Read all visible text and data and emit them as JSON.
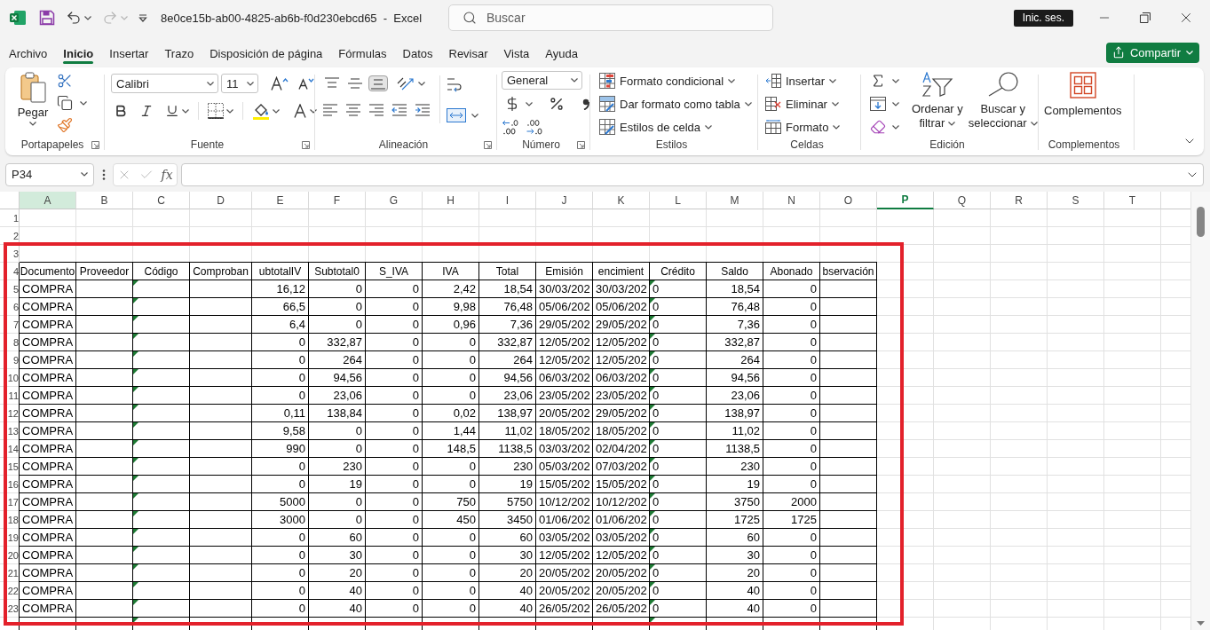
{
  "title_bar": {
    "title": "8e0ce15b-ab00-4825-ab6b-f0d230ebcd65  -  Excel",
    "redo": {
      "disabled": true
    },
    "search": {
      "placeholder": "Buscar"
    },
    "sign_in": "Inic. ses."
  },
  "menu": {
    "tabs": [
      {
        "label": "Archivo",
        "selected": false
      },
      {
        "label": "Inicio",
        "selected": true
      },
      {
        "label": "Insertar",
        "selected": false
      },
      {
        "label": "Trazo",
        "selected": false
      },
      {
        "label": "Disposición de página",
        "selected": false
      },
      {
        "label": "Fórmulas",
        "selected": false
      },
      {
        "label": "Datos",
        "selected": false
      },
      {
        "label": "Revisar",
        "selected": false
      },
      {
        "label": "Vista",
        "selected": false
      },
      {
        "label": "Ayuda",
        "selected": false
      }
    ],
    "share": "Compartir"
  },
  "ribbon": {
    "clipboard": {
      "paste": "Pegar",
      "label": "Portapapeles"
    },
    "font": {
      "font_name": "Calibri",
      "font_size": "11",
      "label": "Fuente"
    },
    "alignment": {
      "vertical": [
        {
          "selected": false
        },
        {
          "selected": false
        },
        {
          "selected": true
        }
      ],
      "label": "Alineación"
    },
    "number": {
      "format": "General",
      "label": "Número"
    },
    "styles": {
      "items": [
        "Formato condicional",
        "Dar formato como tabla",
        "Estilos de celda"
      ],
      "label": "Estilos"
    },
    "cells": {
      "items": [
        "Insertar",
        "Eliminar",
        "Formato"
      ],
      "label": "Celdas"
    },
    "editing": {
      "sort": [
        "Ordenar y",
        "filtrar"
      ],
      "find": [
        "Buscar y",
        "seleccionar"
      ],
      "label": "Edición"
    },
    "add_ins": {
      "button": "Complementos",
      "label": "Complementos"
    }
  },
  "formula_bar": {
    "name_box": "P34",
    "edit_buttons": {
      "disabled": true
    },
    "function_label": "fx"
  },
  "sheet": {
    "columns": [
      {
        "letter": "A",
        "selected": false,
        "shaded": true,
        "flagged": false,
        "right_aligned": false
      },
      {
        "letter": "B",
        "selected": false,
        "shaded": false,
        "flagged": false
      },
      {
        "letter": "C",
        "selected": false,
        "shaded": false,
        "flagged": true
      },
      {
        "letter": "D",
        "selected": false,
        "shaded": false,
        "flagged": false
      },
      {
        "letter": "E",
        "selected": false,
        "shaded": false,
        "flagged": false,
        "right_aligned": true
      },
      {
        "letter": "F",
        "selected": false,
        "shaded": false,
        "flagged": false,
        "right_aligned": true
      },
      {
        "letter": "G",
        "selected": false,
        "shaded": false,
        "flagged": false,
        "right_aligned": true
      },
      {
        "letter": "H",
        "selected": false,
        "shaded": false,
        "flagged": false,
        "right_aligned": true
      },
      {
        "letter": "I",
        "selected": false,
        "shaded": false,
        "flagged": false,
        "right_aligned": true
      },
      {
        "letter": "J",
        "selected": false,
        "shaded": false,
        "flagged": false,
        "right_aligned": false
      },
      {
        "letter": "K",
        "selected": false,
        "shaded": false,
        "flagged": false,
        "right_aligned": false
      },
      {
        "letter": "L",
        "selected": false,
        "shaded": false,
        "flagged": true,
        "right_aligned": false
      },
      {
        "letter": "M",
        "selected": false,
        "shaded": false,
        "flagged": false,
        "right_aligned": true
      },
      {
        "letter": "N",
        "selected": false,
        "shaded": false,
        "flagged": false,
        "right_aligned": true
      },
      {
        "letter": "O",
        "selected": false,
        "shaded": false,
        "flagged": false
      },
      {
        "letter": "P",
        "selected": true,
        "shaded": false,
        "flagged": false
      },
      {
        "letter": "Q",
        "selected": false,
        "shaded": false,
        "flagged": false
      },
      {
        "letter": "R",
        "selected": false,
        "shaded": false,
        "flagged": false
      },
      {
        "letter": "S",
        "selected": false,
        "shaded": false,
        "flagged": false
      },
      {
        "letter": "T",
        "selected": false,
        "shaded": false,
        "flagged": false
      }
    ],
    "rows": [
      {
        "number": "1",
        "kind": "blank"
      },
      {
        "number": "2",
        "kind": "blank"
      },
      {
        "number": "3",
        "kind": "blank"
      },
      {
        "number": "4",
        "kind": "header",
        "cells": [
          "Documento",
          "Proveedor",
          "Código",
          "Comproban",
          "ubtotalIV",
          "Subtotal0",
          "S_IVA",
          "IVA",
          "Total",
          "Emisión",
          "encimient",
          "Crédito",
          "Saldo",
          "Abonado",
          "bservación"
        ]
      },
      {
        "number": "5",
        "kind": "data",
        "cells": [
          "COMPRA",
          null,
          null,
          null,
          "16,12",
          "0",
          "0",
          "2,42",
          "18,54",
          "30/03/202",
          "30/03/202",
          "0",
          "18,54",
          "0"
        ]
      },
      {
        "number": "6",
        "kind": "data",
        "cells": [
          "COMPRA",
          null,
          null,
          null,
          "66,5",
          "0",
          "0",
          "9,98",
          "76,48",
          "05/06/202",
          "05/06/202",
          "0",
          "76,48",
          "0"
        ]
      },
      {
        "number": "7",
        "kind": "data",
        "cells": [
          "COMPRA",
          null,
          null,
          null,
          "6,4",
          "0",
          "0",
          "0,96",
          "7,36",
          "29/05/202",
          "29/05/202",
          "0",
          "7,36",
          "0"
        ]
      },
      {
        "number": "8",
        "kind": "data",
        "cells": [
          "COMPRA",
          null,
          null,
          null,
          "0",
          "332,87",
          "0",
          "0",
          "332,87",
          "12/05/202",
          "12/05/202",
          "0",
          "332,87",
          "0"
        ]
      },
      {
        "number": "9",
        "kind": "data",
        "cells": [
          "COMPRA",
          null,
          null,
          null,
          "0",
          "264",
          "0",
          "0",
          "264",
          "12/05/202",
          "12/05/202",
          "0",
          "264",
          "0"
        ]
      },
      {
        "number": "10",
        "kind": "data",
        "cells": [
          "COMPRA",
          null,
          null,
          null,
          "0",
          "94,56",
          "0",
          "0",
          "94,56",
          "06/03/202",
          "06/03/202",
          "0",
          "94,56",
          "0"
        ]
      },
      {
        "number": "11",
        "kind": "data",
        "cells": [
          "COMPRA",
          null,
          null,
          null,
          "0",
          "23,06",
          "0",
          "0",
          "23,06",
          "23/05/202",
          "23/05/202",
          "0",
          "23,06",
          "0"
        ]
      },
      {
        "number": "12",
        "kind": "data",
        "cells": [
          "COMPRA",
          null,
          null,
          null,
          "0,11",
          "138,84",
          "0",
          "0,02",
          "138,97",
          "20/05/202",
          "29/05/202",
          "0",
          "138,97",
          "0"
        ]
      },
      {
        "number": "13",
        "kind": "data",
        "cells": [
          "COMPRA",
          null,
          null,
          null,
          "9,58",
          "0",
          "0",
          "1,44",
          "11,02",
          "18/05/202",
          "18/05/202",
          "0",
          "11,02",
          "0"
        ]
      },
      {
        "number": "14",
        "kind": "data",
        "cells": [
          "COMPRA",
          null,
          null,
          null,
          "990",
          "0",
          "0",
          "148,5",
          "1138,5",
          "03/03/202",
          "02/04/202",
          "0",
          "1138,5",
          "0"
        ]
      },
      {
        "number": "15",
        "kind": "data",
        "cells": [
          "COMPRA",
          null,
          null,
          null,
          "0",
          "230",
          "0",
          "0",
          "230",
          "05/03/202",
          "07/03/202",
          "0",
          "230",
          "0"
        ]
      },
      {
        "number": "16",
        "kind": "data",
        "cells": [
          "COMPRA",
          null,
          null,
          null,
          "0",
          "19",
          "0",
          "0",
          "19",
          "15/05/202",
          "15/05/202",
          "0",
          "19",
          "0"
        ]
      },
      {
        "number": "17",
        "kind": "data",
        "cells": [
          "COMPRA",
          null,
          null,
          null,
          "5000",
          "0",
          "0",
          "750",
          "5750",
          "10/12/202",
          "10/12/202",
          "0",
          "3750",
          "2000"
        ]
      },
      {
        "number": "18",
        "kind": "data",
        "cells": [
          "COMPRA",
          null,
          null,
          null,
          "3000",
          "0",
          "0",
          "450",
          "3450",
          "01/06/202",
          "01/06/202",
          "0",
          "1725",
          "1725"
        ]
      },
      {
        "number": "19",
        "kind": "data",
        "cells": [
          "COMPRA",
          null,
          null,
          null,
          "0",
          "60",
          "0",
          "0",
          "60",
          "03/05/202",
          "03/05/202",
          "0",
          "60",
          "0"
        ]
      },
      {
        "number": "20",
        "kind": "data",
        "cells": [
          "COMPRA",
          null,
          null,
          null,
          "0",
          "30",
          "0",
          "0",
          "30",
          "12/05/202",
          "12/05/202",
          "0",
          "30",
          "0"
        ]
      },
      {
        "number": "21",
        "kind": "data",
        "cells": [
          "COMPRA",
          null,
          null,
          null,
          "0",
          "20",
          "0",
          "0",
          "20",
          "20/05/202",
          "20/05/202",
          "0",
          "20",
          "0"
        ]
      },
      {
        "number": "22",
        "kind": "data",
        "cells": [
          "COMPRA",
          null,
          null,
          null,
          "0",
          "40",
          "0",
          "0",
          "40",
          "20/05/202",
          "20/05/202",
          "0",
          "40",
          "0"
        ]
      },
      {
        "number": "23",
        "kind": "data",
        "cells": [
          "COMPRA",
          null,
          null,
          null,
          "0",
          "40",
          "0",
          "0",
          "40",
          "26/05/202",
          "26/05/202",
          "0",
          "40",
          "0"
        ]
      },
      {
        "kind": "data"
      }
    ]
  },
  "annotation": {
    "kind": "rectangle"
  }
}
